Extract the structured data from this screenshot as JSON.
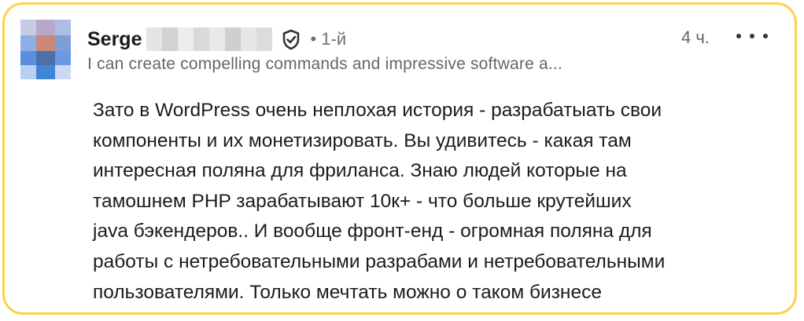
{
  "post": {
    "author_name": "Serge",
    "connection_degree": "• 1-й",
    "headline": "I can create compelling commands and impressive software a...",
    "time_ago": "4 ч.",
    "more_label": "•••",
    "body_lines": [
      "Зато в WordPress очень неплохая история - разрабатыать свои",
      "компоненты и их монетизировать. Вы удивитесь - какая там",
      "интересная поляна для фриланса. Знаю людей которые на",
      "тамошнем PHP зарабатывают 10к+ - что больше крутейших",
      "java бэкендеров.. И вообще фронт-енд - огромная поляна для",
      "работы с нетребовательными разрабами и нетребовательными",
      "пользователями. Только мечтать можно о таком бизнесе"
    ]
  },
  "icons": {
    "verified": "shield-check-icon",
    "avatar": "pixelated-avatar",
    "more": "more-horizontal-icon"
  },
  "colors": {
    "highlight_border": "#f8d34a",
    "text": "#1c1c1c",
    "secondary_text": "#666666"
  }
}
